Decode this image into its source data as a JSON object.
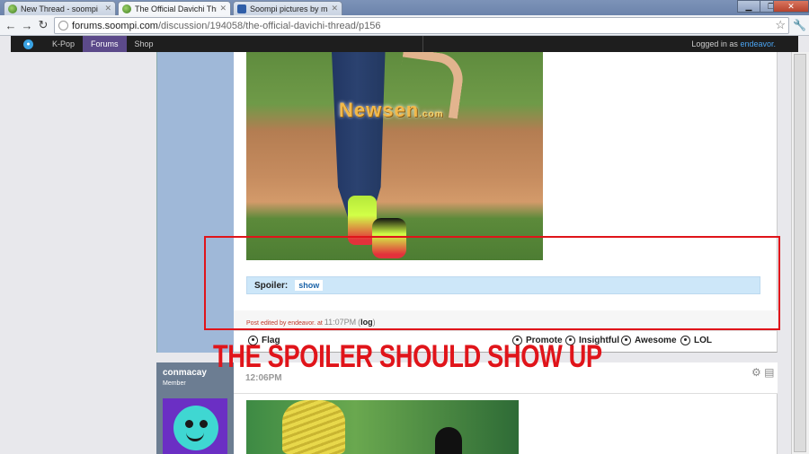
{
  "browser": {
    "tabs": [
      {
        "title": "New Thread - soompi",
        "active": false
      },
      {
        "title": "The Official Davichi Threa",
        "active": true
      },
      {
        "title": "Soompi pictures by maltwi",
        "active": false
      }
    ],
    "url_host": "forums.soompi.com",
    "url_path": "/discussion/194058/the-official-davichi-thread/p156"
  },
  "site_nav": {
    "items": [
      "K-Pop",
      "Forums",
      "Shop"
    ],
    "active": "Forums",
    "logged_in_prefix": "Logged in as",
    "username": "endeavor."
  },
  "post1": {
    "image_watermark": "Newsen",
    "image_watermark_sub": ".com",
    "spoiler_label": "Spoiler:",
    "spoiler_button": "show",
    "edited_prefix": "Post edited by endeavor. at",
    "edited_time": "11:07PM",
    "edited_log": "log",
    "actions_left": [
      "Flag"
    ],
    "actions_right": [
      "Promote",
      "Insightful",
      "Awesome",
      "LOL"
    ]
  },
  "post2": {
    "author": "conmacay",
    "role": "Member",
    "time": "12:06PM"
  },
  "annotation": {
    "text": "THE SPOILER SHOULD SHOW UP",
    "color": "#e0141a"
  }
}
